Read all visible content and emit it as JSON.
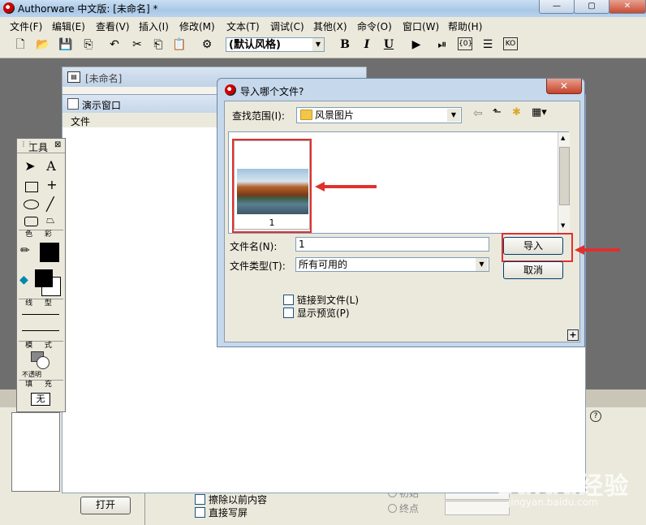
{
  "app": {
    "title": "Authorware 中文版: [未命名] *",
    "window_buttons": [
      "—",
      "▢",
      "✕"
    ]
  },
  "menu": [
    "文件(F)",
    "编辑(E)",
    "查看(V)",
    "插入(I)",
    "修改(M)",
    "文本(T)",
    "调试(C)",
    "其他(X)",
    "命令(O)",
    "窗口(W)",
    "帮助(H)"
  ],
  "toolbar": {
    "style_value": "(默认风格)",
    "bold": "B",
    "italic": "I",
    "underline": "U"
  },
  "untitled_window": {
    "title": "[未命名]"
  },
  "presentation_window": {
    "title": "演示窗口",
    "menu_file": "文件"
  },
  "tools_panel": {
    "title": "工具",
    "tool_text": "A",
    "color_label": "色 彩",
    "line_label": "线 型",
    "mode_label": "模 式",
    "mode_value": "不透明",
    "fill_label": "填 充",
    "fill_value": "无"
  },
  "dialog": {
    "title": "导入哪个文件?",
    "look_in_label": "查找范围(I):",
    "look_in_value": "风景图片",
    "files": [
      {
        "name": "1"
      }
    ],
    "filename_label": "文件名(N):",
    "filename_value": "1",
    "filetype_label": "文件类型(T):",
    "filetype_value": "所有可用的",
    "import_button": "导入",
    "cancel_button": "取消",
    "link_checkbox": "链接到文件(L)",
    "preview_checkbox": "显示预览(P)",
    "link_checked": false,
    "preview_checked": false,
    "expand_button": "+"
  },
  "properties": {
    "open_button": "打开",
    "erase_checkbox": "擦除以前内容",
    "direct_checkbox": "直接写屏",
    "initial_radio": "初始",
    "end_radio": "终点",
    "help_icon": "?"
  },
  "watermark": {
    "line1": "Baidu经验",
    "line2": "jingyan.baidu.com"
  },
  "colors": {
    "annotation": "#e0302e",
    "titlebar": "#b8d3ee",
    "chrome": "#ebe9dc"
  }
}
